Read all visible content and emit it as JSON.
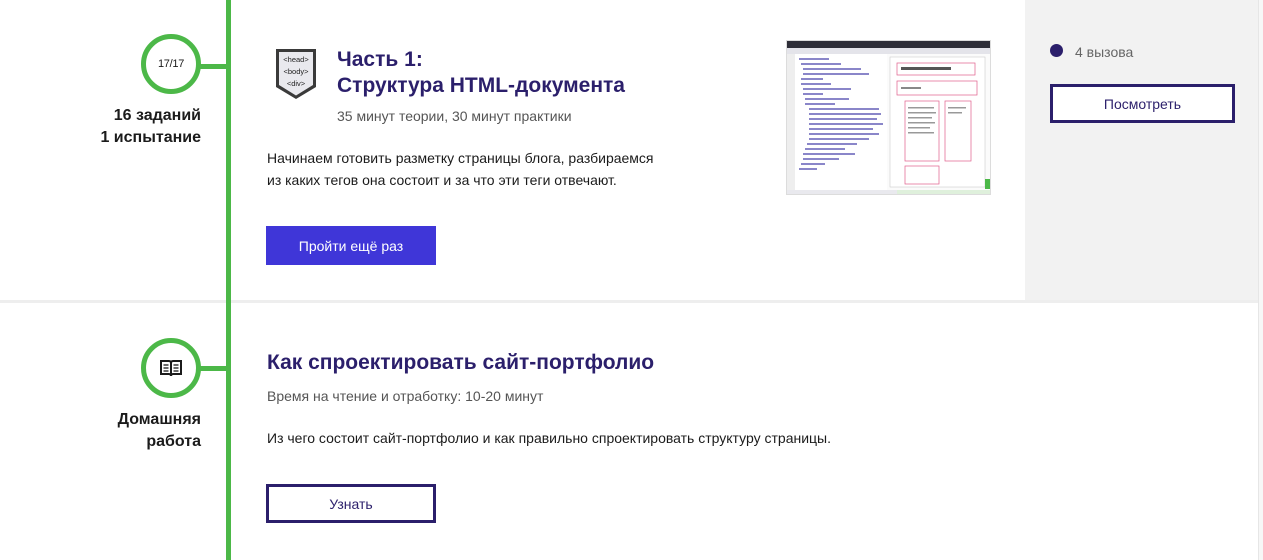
{
  "colors": {
    "timeline": "#4cb848",
    "accent": "#3f36d8",
    "title": "#2b1f6b",
    "side_panel": "#f2f2f2"
  },
  "step1": {
    "node_text": "17/17",
    "label_line1": "16 заданий",
    "label_line2": "1 испытание",
    "badge_icon": "html-tags-icon",
    "badge_lines": [
      "<head>",
      "<body>",
      "<div>"
    ],
    "title_line1": "Часть 1:",
    "title_line2": "Структура HTML-документа",
    "subtitle": "35 минут теории, 30 минут практики",
    "desc_line1": "Начинаем готовить разметку страницы блога, разбираемся",
    "desc_line2": "из каких тегов она состоит и за что эти теги отвечают.",
    "button_label": "Пройти ещё раз",
    "side": {
      "challenges": "4 вызова",
      "view_button": "Посмотреть"
    }
  },
  "step2": {
    "node_icon": "book-icon",
    "label_line1": "Домашняя",
    "label_line2": "работа",
    "title": "Как спроектировать сайт-портфолио",
    "subtitle": "Время на чтение и отработку: 10-20 минут",
    "desc": "Из чего состоит сайт-портфолио и как правильно спроектировать структуру страницы.",
    "button_label": "Узнать"
  }
}
